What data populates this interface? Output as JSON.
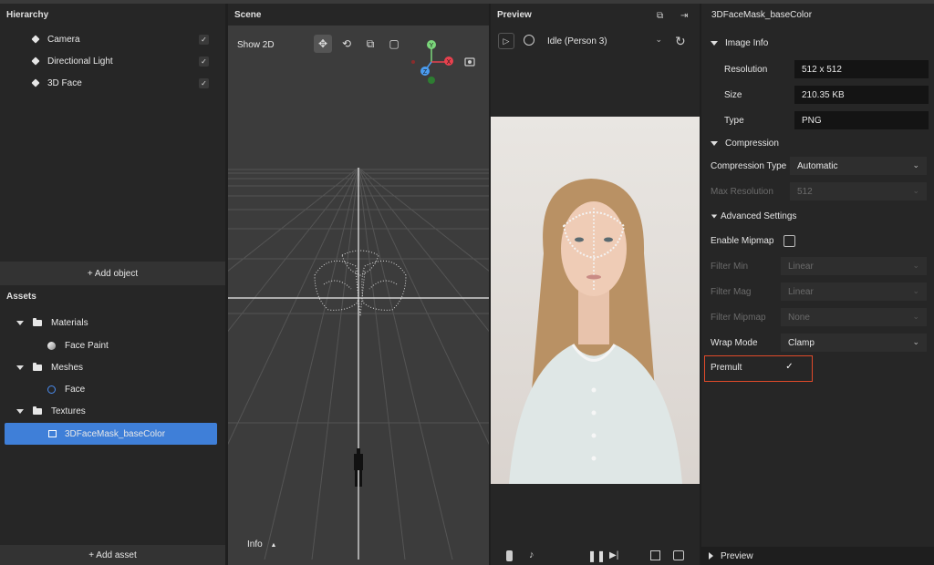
{
  "hierarchy": {
    "title": "Hierarchy",
    "items": [
      {
        "label": "Camera",
        "checked": true
      },
      {
        "label": "Directional Light",
        "checked": true
      },
      {
        "label": "3D Face",
        "checked": true
      }
    ],
    "add_object": "+ Add object"
  },
  "assets": {
    "title": "Assets",
    "tree": [
      {
        "label": "Materials",
        "type": "folder"
      },
      {
        "label": "Face Paint",
        "type": "material"
      },
      {
        "label": "Meshes",
        "type": "folder"
      },
      {
        "label": "Face",
        "type": "mesh"
      },
      {
        "label": "Textures",
        "type": "folder"
      },
      {
        "label": "3DFaceMask_baseColor",
        "type": "texture",
        "selected": true
      }
    ],
    "add_asset": "+ Add asset"
  },
  "scene": {
    "title": "Scene",
    "show2d": "Show 2D",
    "info": "Info",
    "gizmo": {
      "y": "Y",
      "x": "X",
      "z": "Z"
    }
  },
  "preview": {
    "title": "Preview",
    "device": "Idle (Person 3)"
  },
  "inspector": {
    "title": "3DFaceMask_baseColor",
    "image_info": "Image Info",
    "resolution_label": "Resolution",
    "resolution_value": "512 x 512",
    "size_label": "Size",
    "size_value": "210.35 KB",
    "type_label": "Type",
    "type_value": "PNG",
    "compression": "Compression",
    "compression_type_label": "Compression Type",
    "compression_type_value": "Automatic",
    "max_resolution_label": "Max Resolution",
    "max_resolution_value": "512",
    "advanced": "Advanced Settings",
    "mipmap_label": "Enable Mipmap",
    "filter_min_label": "Filter Min",
    "filter_min_value": "Linear",
    "filter_mag_label": "Filter Mag",
    "filter_mag_value": "Linear",
    "filter_mipmap_label": "Filter Mipmap",
    "filter_mipmap_value": "None",
    "wrap_label": "Wrap Mode",
    "wrap_value": "Clamp",
    "premult_label": "Premult",
    "premult_checked": true,
    "preview_section": "Preview"
  },
  "colors": {
    "selected": "#3f7fd8",
    "highlight": "#e04a2a",
    "gizmo_x": "#e8414e",
    "gizmo_y": "#7bd67b",
    "gizmo_z": "#4a9cf0"
  }
}
